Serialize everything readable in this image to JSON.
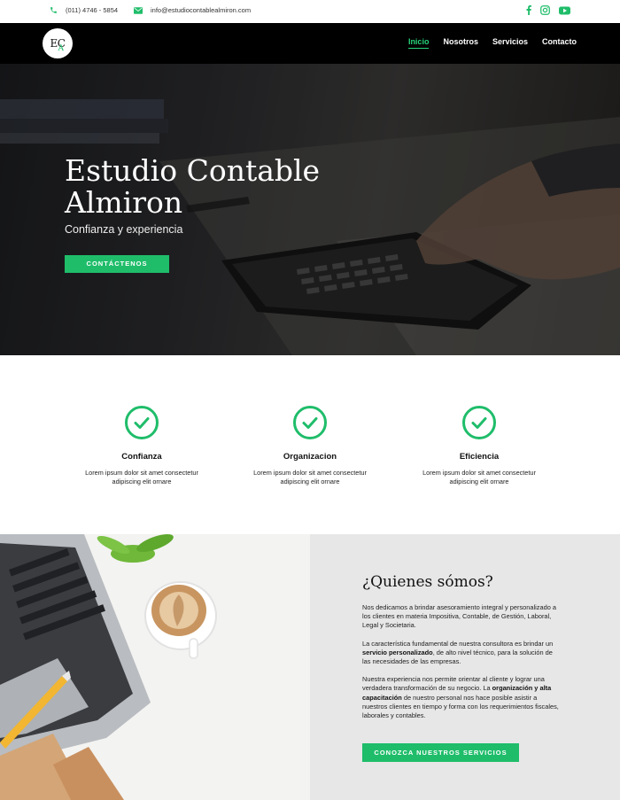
{
  "topbar": {
    "phone": "(011) 4746 - 5854",
    "email": "info@estudiocontablealmiron.com",
    "social": [
      "facebook-icon",
      "instagram-icon",
      "youtube-icon"
    ]
  },
  "nav": {
    "logo_text": "EC",
    "logo_accent": "A",
    "items": [
      {
        "label": "Inicio",
        "active": true
      },
      {
        "label": "Nosotros",
        "active": false
      },
      {
        "label": "Servicios",
        "active": false
      },
      {
        "label": "Contacto",
        "active": false
      }
    ]
  },
  "hero": {
    "title": "Estudio Contable Almiron",
    "subtitle": "Confianza y experiencia",
    "cta": "CONTÁCTENOS"
  },
  "features": [
    {
      "title": "Confianza",
      "text": "Lorem ipsum dolor sit amet consectetur adipiscing elit ornare"
    },
    {
      "title": "Organizacion",
      "text": "Lorem ipsum dolor sit amet consectetur adipiscing elit ornare"
    },
    {
      "title": "Eficiencia",
      "text": "Lorem ipsum dolor sit amet consectetur adipiscing elit ornare"
    }
  ],
  "about": {
    "title": "¿Quienes sómos?",
    "p1": "Nos dedicamos a brindar asesoramiento integral y personalizado a los clientes en materia Impositiva, Contable, de Gestión, Laboral, Legal y Societaria.",
    "p2_pre": "La característica fundamental de nuestra consultora es brindar un ",
    "p2_bold": "servicio personalizado",
    "p2_post": ", de alto nivel técnico, para la solución de las necesidades de las empresas.",
    "p3_pre": "Nuestra experiencia nos permite orientar al cliente y lograr una verdadera transformación de su negocio. La ",
    "p3_bold": "organización y alta capacitación",
    "p3_post": " de nuestro personal nos hace posible asistir a nuestros clientes en tiempo y forma con los requerimientos fiscales, laborales y contables.",
    "cta": "CONOZCA NUESTROS SERVICIOS"
  },
  "colors": {
    "accent": "#1fbd6a",
    "nav_bg": "#000000",
    "about_bg": "#e7e7e7"
  }
}
